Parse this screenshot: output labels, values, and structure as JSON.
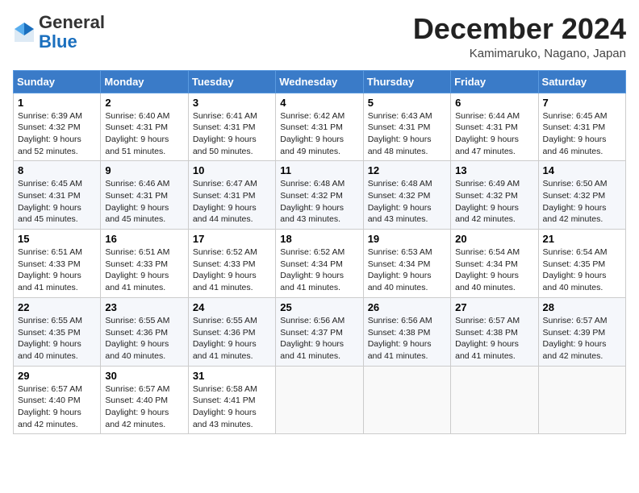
{
  "header": {
    "logo_general": "General",
    "logo_blue": "Blue",
    "month_title": "December 2024",
    "location": "Kamimaruko, Nagano, Japan"
  },
  "weekdays": [
    "Sunday",
    "Monday",
    "Tuesday",
    "Wednesday",
    "Thursday",
    "Friday",
    "Saturday"
  ],
  "weeks": [
    [
      {
        "day": "1",
        "info": "Sunrise: 6:39 AM\nSunset: 4:32 PM\nDaylight: 9 hours\nand 52 minutes."
      },
      {
        "day": "2",
        "info": "Sunrise: 6:40 AM\nSunset: 4:31 PM\nDaylight: 9 hours\nand 51 minutes."
      },
      {
        "day": "3",
        "info": "Sunrise: 6:41 AM\nSunset: 4:31 PM\nDaylight: 9 hours\nand 50 minutes."
      },
      {
        "day": "4",
        "info": "Sunrise: 6:42 AM\nSunset: 4:31 PM\nDaylight: 9 hours\nand 49 minutes."
      },
      {
        "day": "5",
        "info": "Sunrise: 6:43 AM\nSunset: 4:31 PM\nDaylight: 9 hours\nand 48 minutes."
      },
      {
        "day": "6",
        "info": "Sunrise: 6:44 AM\nSunset: 4:31 PM\nDaylight: 9 hours\nand 47 minutes."
      },
      {
        "day": "7",
        "info": "Sunrise: 6:45 AM\nSunset: 4:31 PM\nDaylight: 9 hours\nand 46 minutes."
      }
    ],
    [
      {
        "day": "8",
        "info": "Sunrise: 6:45 AM\nSunset: 4:31 PM\nDaylight: 9 hours\nand 45 minutes."
      },
      {
        "day": "9",
        "info": "Sunrise: 6:46 AM\nSunset: 4:31 PM\nDaylight: 9 hours\nand 45 minutes."
      },
      {
        "day": "10",
        "info": "Sunrise: 6:47 AM\nSunset: 4:31 PM\nDaylight: 9 hours\nand 44 minutes."
      },
      {
        "day": "11",
        "info": "Sunrise: 6:48 AM\nSunset: 4:32 PM\nDaylight: 9 hours\nand 43 minutes."
      },
      {
        "day": "12",
        "info": "Sunrise: 6:48 AM\nSunset: 4:32 PM\nDaylight: 9 hours\nand 43 minutes."
      },
      {
        "day": "13",
        "info": "Sunrise: 6:49 AM\nSunset: 4:32 PM\nDaylight: 9 hours\nand 42 minutes."
      },
      {
        "day": "14",
        "info": "Sunrise: 6:50 AM\nSunset: 4:32 PM\nDaylight: 9 hours\nand 42 minutes."
      }
    ],
    [
      {
        "day": "15",
        "info": "Sunrise: 6:51 AM\nSunset: 4:33 PM\nDaylight: 9 hours\nand 41 minutes."
      },
      {
        "day": "16",
        "info": "Sunrise: 6:51 AM\nSunset: 4:33 PM\nDaylight: 9 hours\nand 41 minutes."
      },
      {
        "day": "17",
        "info": "Sunrise: 6:52 AM\nSunset: 4:33 PM\nDaylight: 9 hours\nand 41 minutes."
      },
      {
        "day": "18",
        "info": "Sunrise: 6:52 AM\nSunset: 4:34 PM\nDaylight: 9 hours\nand 41 minutes."
      },
      {
        "day": "19",
        "info": "Sunrise: 6:53 AM\nSunset: 4:34 PM\nDaylight: 9 hours\nand 40 minutes."
      },
      {
        "day": "20",
        "info": "Sunrise: 6:54 AM\nSunset: 4:34 PM\nDaylight: 9 hours\nand 40 minutes."
      },
      {
        "day": "21",
        "info": "Sunrise: 6:54 AM\nSunset: 4:35 PM\nDaylight: 9 hours\nand 40 minutes."
      }
    ],
    [
      {
        "day": "22",
        "info": "Sunrise: 6:55 AM\nSunset: 4:35 PM\nDaylight: 9 hours\nand 40 minutes."
      },
      {
        "day": "23",
        "info": "Sunrise: 6:55 AM\nSunset: 4:36 PM\nDaylight: 9 hours\nand 40 minutes."
      },
      {
        "day": "24",
        "info": "Sunrise: 6:55 AM\nSunset: 4:36 PM\nDaylight: 9 hours\nand 41 minutes."
      },
      {
        "day": "25",
        "info": "Sunrise: 6:56 AM\nSunset: 4:37 PM\nDaylight: 9 hours\nand 41 minutes."
      },
      {
        "day": "26",
        "info": "Sunrise: 6:56 AM\nSunset: 4:38 PM\nDaylight: 9 hours\nand 41 minutes."
      },
      {
        "day": "27",
        "info": "Sunrise: 6:57 AM\nSunset: 4:38 PM\nDaylight: 9 hours\nand 41 minutes."
      },
      {
        "day": "28",
        "info": "Sunrise: 6:57 AM\nSunset: 4:39 PM\nDaylight: 9 hours\nand 42 minutes."
      }
    ],
    [
      {
        "day": "29",
        "info": "Sunrise: 6:57 AM\nSunset: 4:40 PM\nDaylight: 9 hours\nand 42 minutes."
      },
      {
        "day": "30",
        "info": "Sunrise: 6:57 AM\nSunset: 4:40 PM\nDaylight: 9 hours\nand 42 minutes."
      },
      {
        "day": "31",
        "info": "Sunrise: 6:58 AM\nSunset: 4:41 PM\nDaylight: 9 hours\nand 43 minutes."
      },
      null,
      null,
      null,
      null
    ]
  ]
}
